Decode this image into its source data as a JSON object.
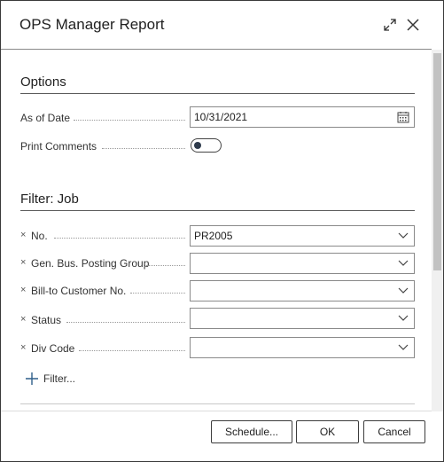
{
  "dialog": {
    "title": "OPS Manager Report",
    "expand_icon": "expand-icon",
    "close_icon": "close-icon"
  },
  "options": {
    "heading": "Options",
    "as_of_date": {
      "label": "As of Date",
      "value": "10/31/2021",
      "icon": "calendar-icon"
    },
    "print_comments": {
      "label": "Print Comments",
      "checked": false
    }
  },
  "filter": {
    "heading": "Filter: Job",
    "rows": [
      {
        "label": "No.",
        "value": "PR2005"
      },
      {
        "label": "Gen. Bus. Posting Group",
        "value": ""
      },
      {
        "label": "Bill-to Customer No.",
        "value": ""
      },
      {
        "label": "Status",
        "value": ""
      },
      {
        "label": "Div Code",
        "value": ""
      }
    ],
    "remove_glyph": "×",
    "add_filter_label": "Filter..."
  },
  "buttons": {
    "schedule": "Schedule...",
    "ok": "OK",
    "cancel": "Cancel"
  },
  "colors": {
    "toggle_knob": "#2f3b4c",
    "border": "#8a8a8a"
  }
}
